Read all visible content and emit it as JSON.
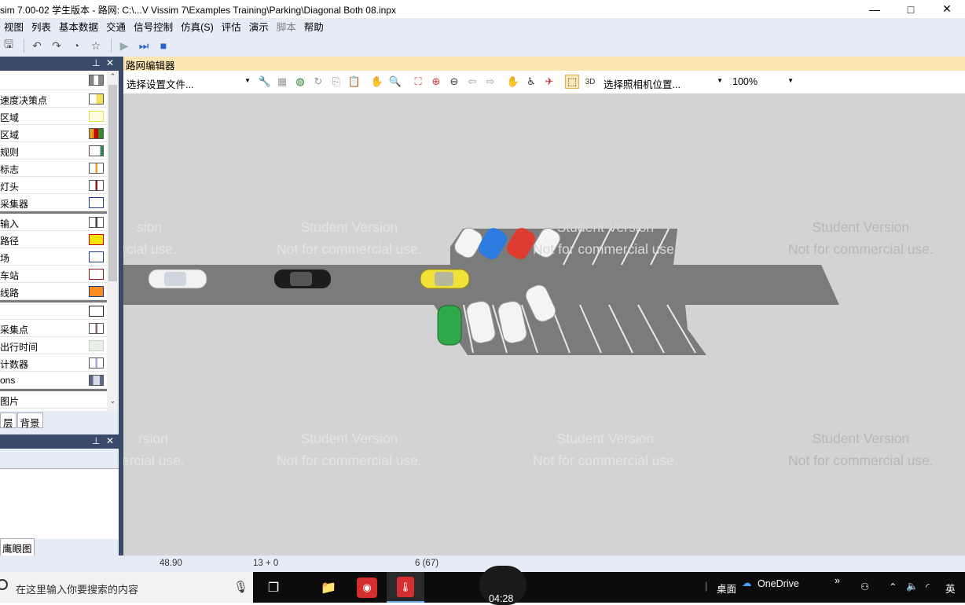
{
  "window": {
    "title": "sim 7.00-02 学生版本 - 路网: C:\\...V Vissim 7\\Examples Training\\Parking\\Diagonal Both 08.inpx",
    "controls": [
      "—",
      "□",
      "✕"
    ]
  },
  "menu": [
    "视图",
    "列表",
    "基本数据",
    "交通",
    "信号控制",
    "仿真(S)",
    "评估",
    "演示",
    "脚本",
    "帮助"
  ],
  "layers_panel": {
    "items": [
      {
        "label": "速度决策点",
        "color": "#f5e15a"
      },
      {
        "label": "区域",
        "color": "#ffff80"
      },
      {
        "label": "区域",
        "color": "#e0a020"
      },
      {
        "label": "规则",
        "color": "#2e8b57"
      },
      {
        "label": "标志",
        "color": "#f0a020"
      },
      {
        "label": "灯头",
        "color": "#8b1a1a"
      },
      {
        "label": "采集器",
        "color": "#1e3a8a"
      },
      {
        "label": "输入",
        "color": "#444444"
      },
      {
        "label": "路径",
        "color": "#f6e400"
      },
      {
        "label": "场",
        "color": "#1e3a8a"
      },
      {
        "label": "车站",
        "color": "#8b1a1a"
      },
      {
        "label": "线路",
        "color": "#ff8c1a"
      },
      {
        "label": "",
        "color": "#222222"
      },
      {
        "label": "采集点",
        "color": "#8b6a6a"
      },
      {
        "label": "出行时间",
        "color": "#c8e6c8"
      },
      {
        "label": "计数器",
        "color": "#b8a0e0"
      },
      {
        "label": "ons",
        "color": "#5a6a8a"
      },
      {
        "label": "图片",
        "color": ""
      }
    ],
    "tabs": [
      "层",
      "背景"
    ]
  },
  "bottom_panel": {
    "tab": "鹰眼图"
  },
  "editor": {
    "title": "路网编辑器",
    "settings_combo": "选择设置文件...",
    "camera_combo": "选择照相机位置...",
    "zoom": "100%",
    "watermark_line1": "Student Version",
    "watermark_line2": "Not for commercial use.",
    "watermark_partial_1": "sion",
    "watermark_partial_2": "rcial use.",
    "watermark_partial_3": "rsion",
    "watermark_partial_4": "ercial use."
  },
  "status": {
    "coordinate": "48.90",
    "vehicles": "13 + 0",
    "time": "6 (67)"
  },
  "taskbar": {
    "search_placeholder": "在这里输入你要搜索的内容",
    "clock": "04:28",
    "desktop": "桌面",
    "onedrive": "OneDrive",
    "ime": "英"
  }
}
